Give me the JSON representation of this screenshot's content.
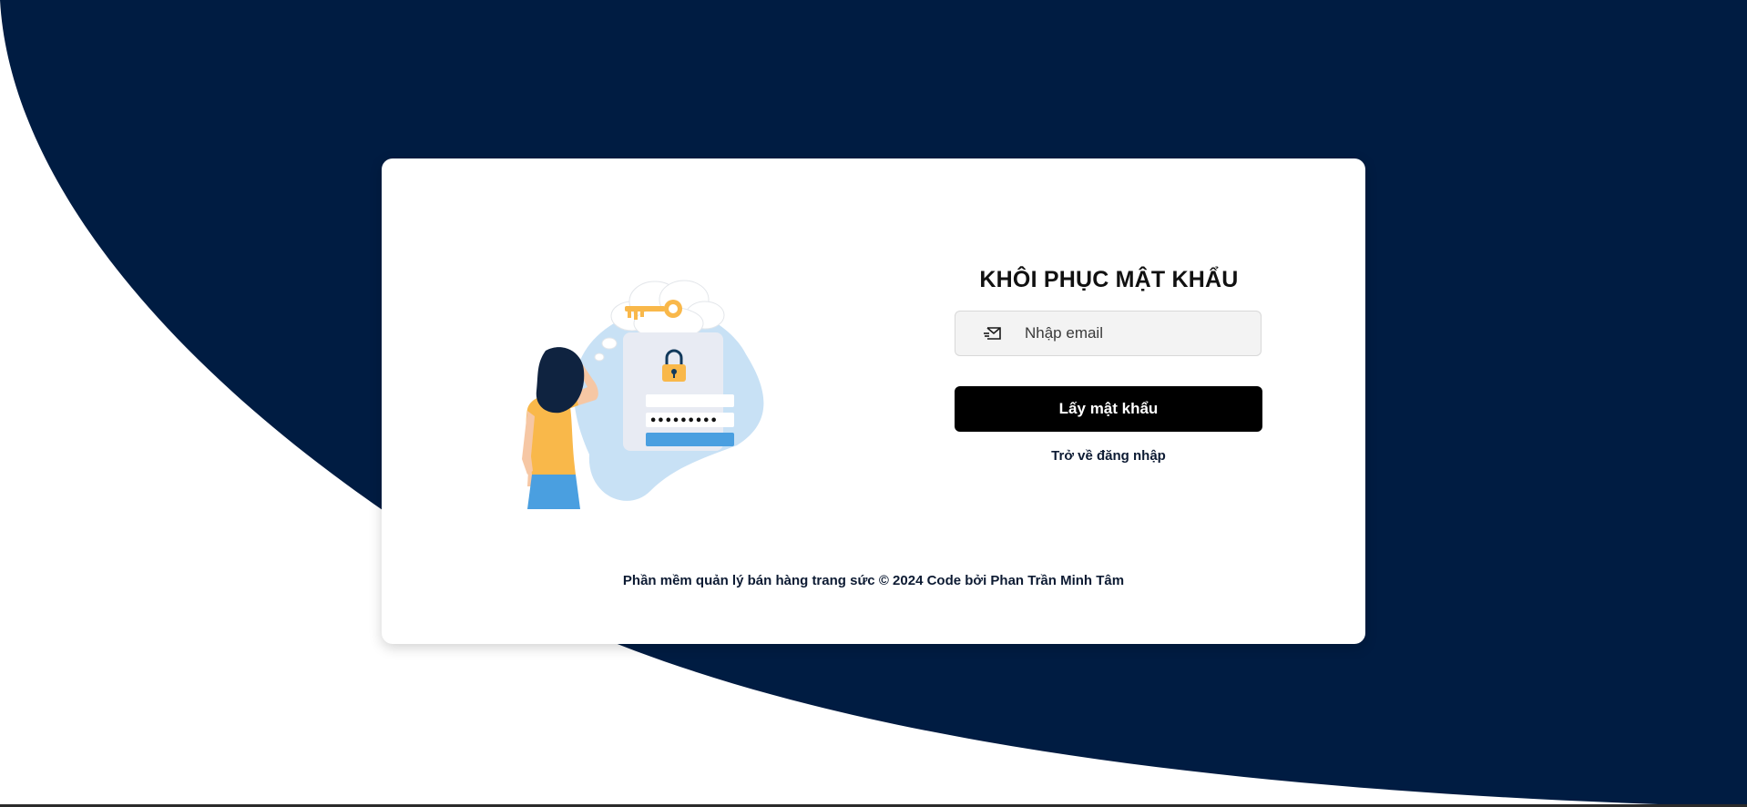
{
  "colors": {
    "navy": "#001c42",
    "button": "#000000",
    "illustration_accent": "#f9b84a",
    "illustration_blue": "#4a9fe0"
  },
  "form": {
    "title": "KHÔI PHỤC MẬT KHẨU",
    "email_placeholder": "Nhập email",
    "email_value": "",
    "email_icon": "mail-icon",
    "submit_label": "Lấy mật khẩu",
    "back_link": "Trở về đăng nhập"
  },
  "footer": {
    "text": "Phần mềm quản lý bán hàng trang sức © 2024 Code bởi Phan Trần Minh Tâm"
  },
  "illustration": {
    "password_mask": "•••••••••"
  }
}
